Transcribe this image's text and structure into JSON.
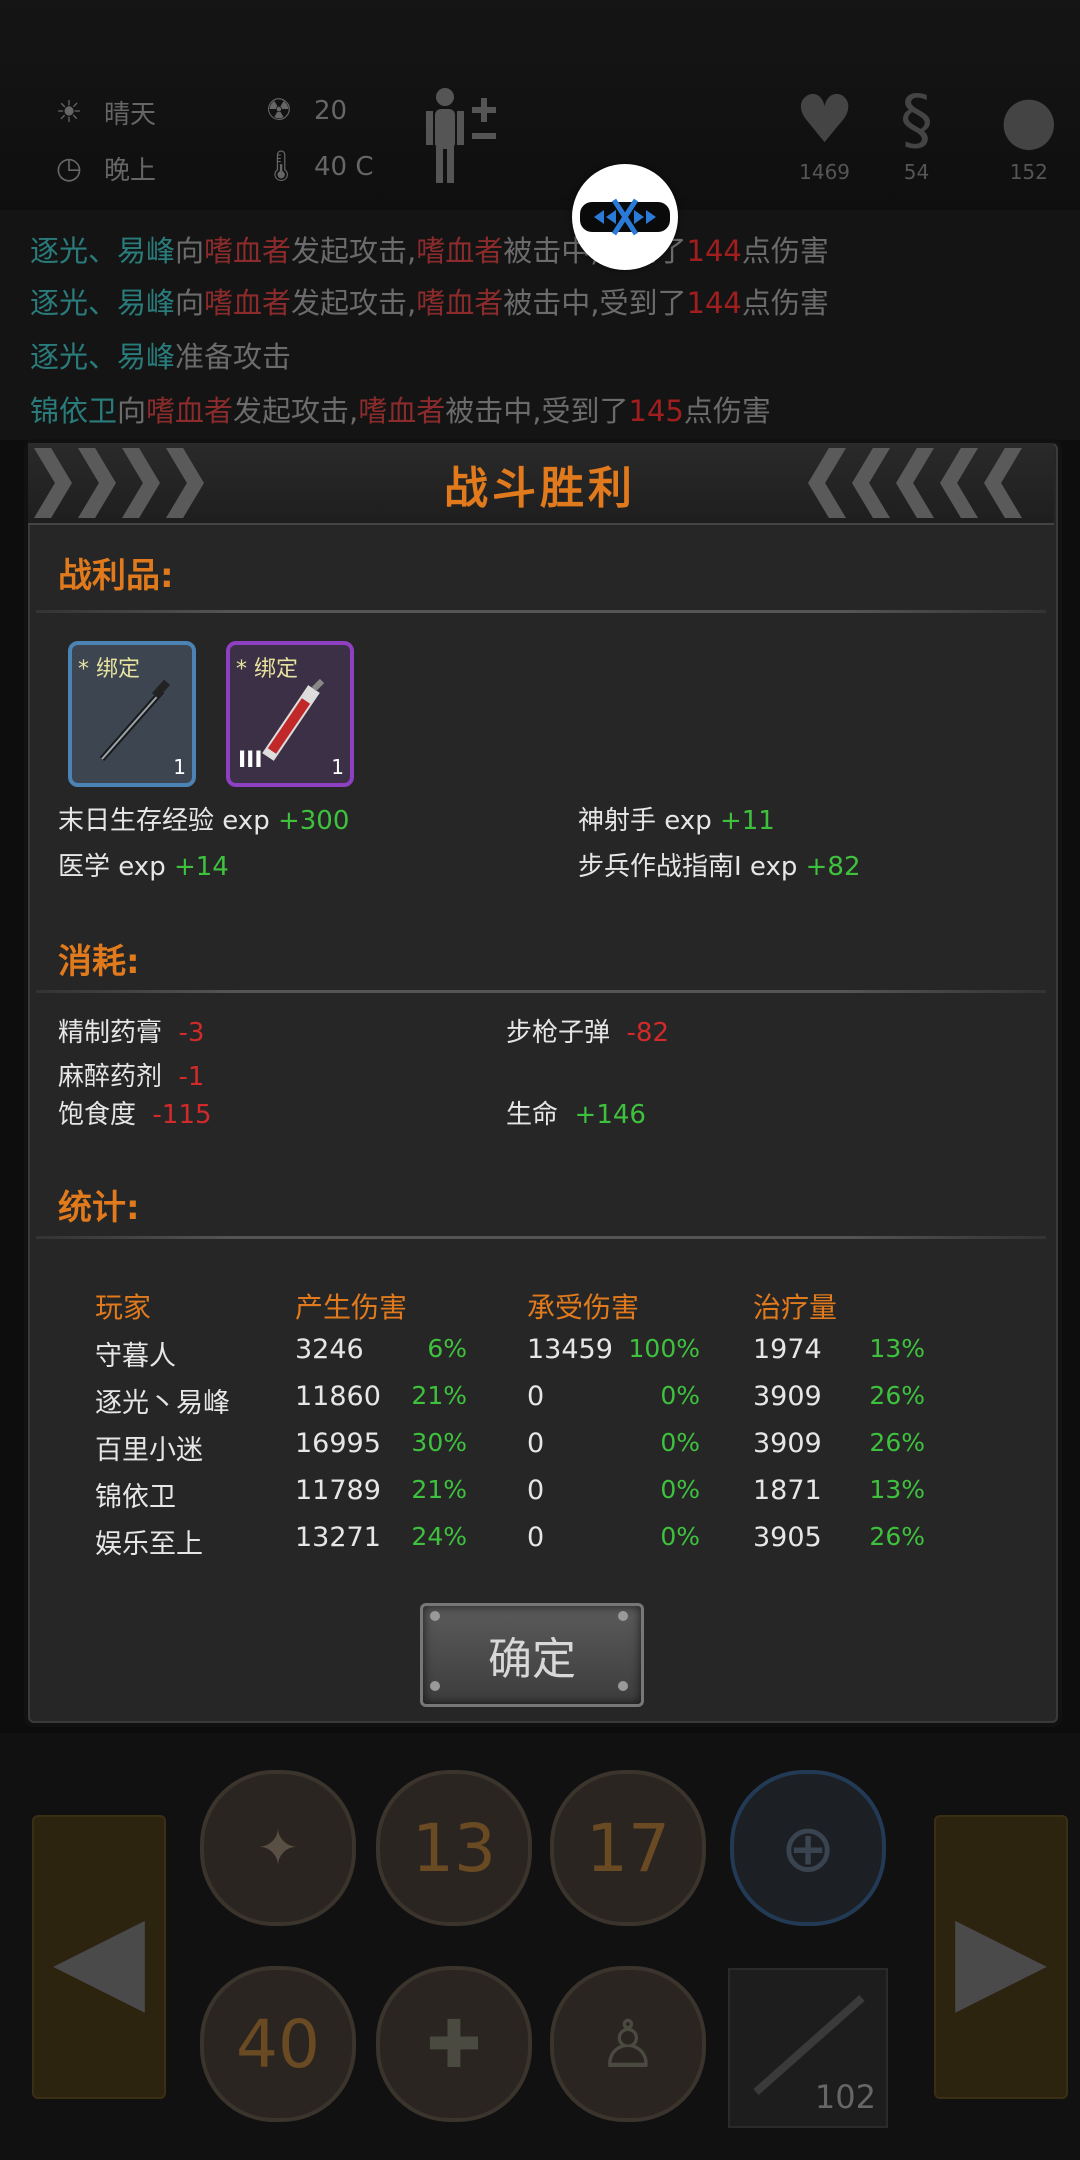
{
  "status": {
    "weather": "晴天",
    "time_of_day": "晚上",
    "radiation": "20",
    "temperature": "40 C"
  },
  "vitals": {
    "health": "1469",
    "hunger": "54",
    "mood": "152"
  },
  "log_lines": [
    {
      "actor": "逐光、易峰",
      "verb": "向",
      "target": "嗜血者",
      "mid": "发起攻击,",
      "target2": "嗜血者",
      "mid2": "被击中,受到了",
      "dmg": "144",
      "end": "点伤害"
    },
    {
      "actor": "逐光、易峰",
      "verb": "向",
      "target": "嗜血者",
      "mid": "发起攻击,",
      "target2": "嗜血者",
      "mid2": "被击中,受到了",
      "dmg": "144",
      "end": "点伤害"
    },
    {
      "actor": "逐光、易峰",
      "verb": "准备攻击",
      "target": "",
      "mid": "",
      "target2": "",
      "mid2": "",
      "dmg": "",
      "end": ""
    },
    {
      "actor": "锦依卫",
      "verb": "向",
      "target": "嗜血者",
      "mid": "发起攻击,",
      "target2": "嗜血者",
      "mid2": "被击中,受到了",
      "dmg": "145",
      "end": "点伤害"
    }
  ],
  "panel": {
    "title": "战斗胜利",
    "loot_title": "战利品:",
    "consume_title": "消耗:",
    "stats_title": "统计:",
    "confirm_label": "确定"
  },
  "loot_items": [
    {
      "tag": "* 绑定",
      "count": "1",
      "tier": "",
      "icon": "nail-icon"
    },
    {
      "tag": "* 绑定",
      "count": "1",
      "tier": "III",
      "icon": "syringe-icon"
    }
  ],
  "exp": [
    {
      "name": "末日生存经验 exp",
      "value": "+300"
    },
    {
      "name": "神射手 exp",
      "value": "+11"
    },
    {
      "name": "医学 exp",
      "value": "+14"
    },
    {
      "name": "步兵作战指南Ⅰ exp",
      "value": "+82"
    }
  ],
  "consumption": [
    {
      "name": "精制药膏",
      "value": "-3",
      "color": "red"
    },
    {
      "name": "步枪子弹",
      "value": "-82",
      "color": "red"
    },
    {
      "name": "麻醉药剂",
      "value": "-1",
      "color": "red"
    },
    {
      "name": "饱食度",
      "value": "-115",
      "color": "red"
    },
    {
      "name": "生命",
      "value": "+146",
      "color": "green"
    }
  ],
  "stats": {
    "headers": [
      "玩家",
      "产生伤害",
      "承受伤害",
      "治疗量"
    ],
    "rows": [
      {
        "player": "守暮人",
        "dealt": "3246",
        "dealt_pct": "6%",
        "taken": "13459",
        "taken_pct": "100%",
        "heal": "1974",
        "heal_pct": "13%"
      },
      {
        "player": "逐光丶易峰",
        "dealt": "11860",
        "dealt_pct": "21%",
        "taken": "0",
        "taken_pct": "0%",
        "heal": "3909",
        "heal_pct": "26%"
      },
      {
        "player": "百里小迷",
        "dealt": "16995",
        "dealt_pct": "30%",
        "taken": "0",
        "taken_pct": "0%",
        "heal": "3909",
        "heal_pct": "26%"
      },
      {
        "player": "锦依卫",
        "dealt": "11789",
        "dealt_pct": "21%",
        "taken": "0",
        "taken_pct": "0%",
        "heal": "1871",
        "heal_pct": "13%"
      },
      {
        "player": "娱乐至上",
        "dealt": "13271",
        "dealt_pct": "24%",
        "taken": "0",
        "taken_pct": "0%",
        "heal": "3905",
        "heal_pct": "26%"
      }
    ]
  },
  "bottom": {
    "skill_counts": [
      "13",
      "17",
      "40"
    ],
    "ammo": "102"
  },
  "colors": {
    "accent": "#e07a1c",
    "positive": "#3ec23e",
    "negative": "#d22a2a"
  }
}
